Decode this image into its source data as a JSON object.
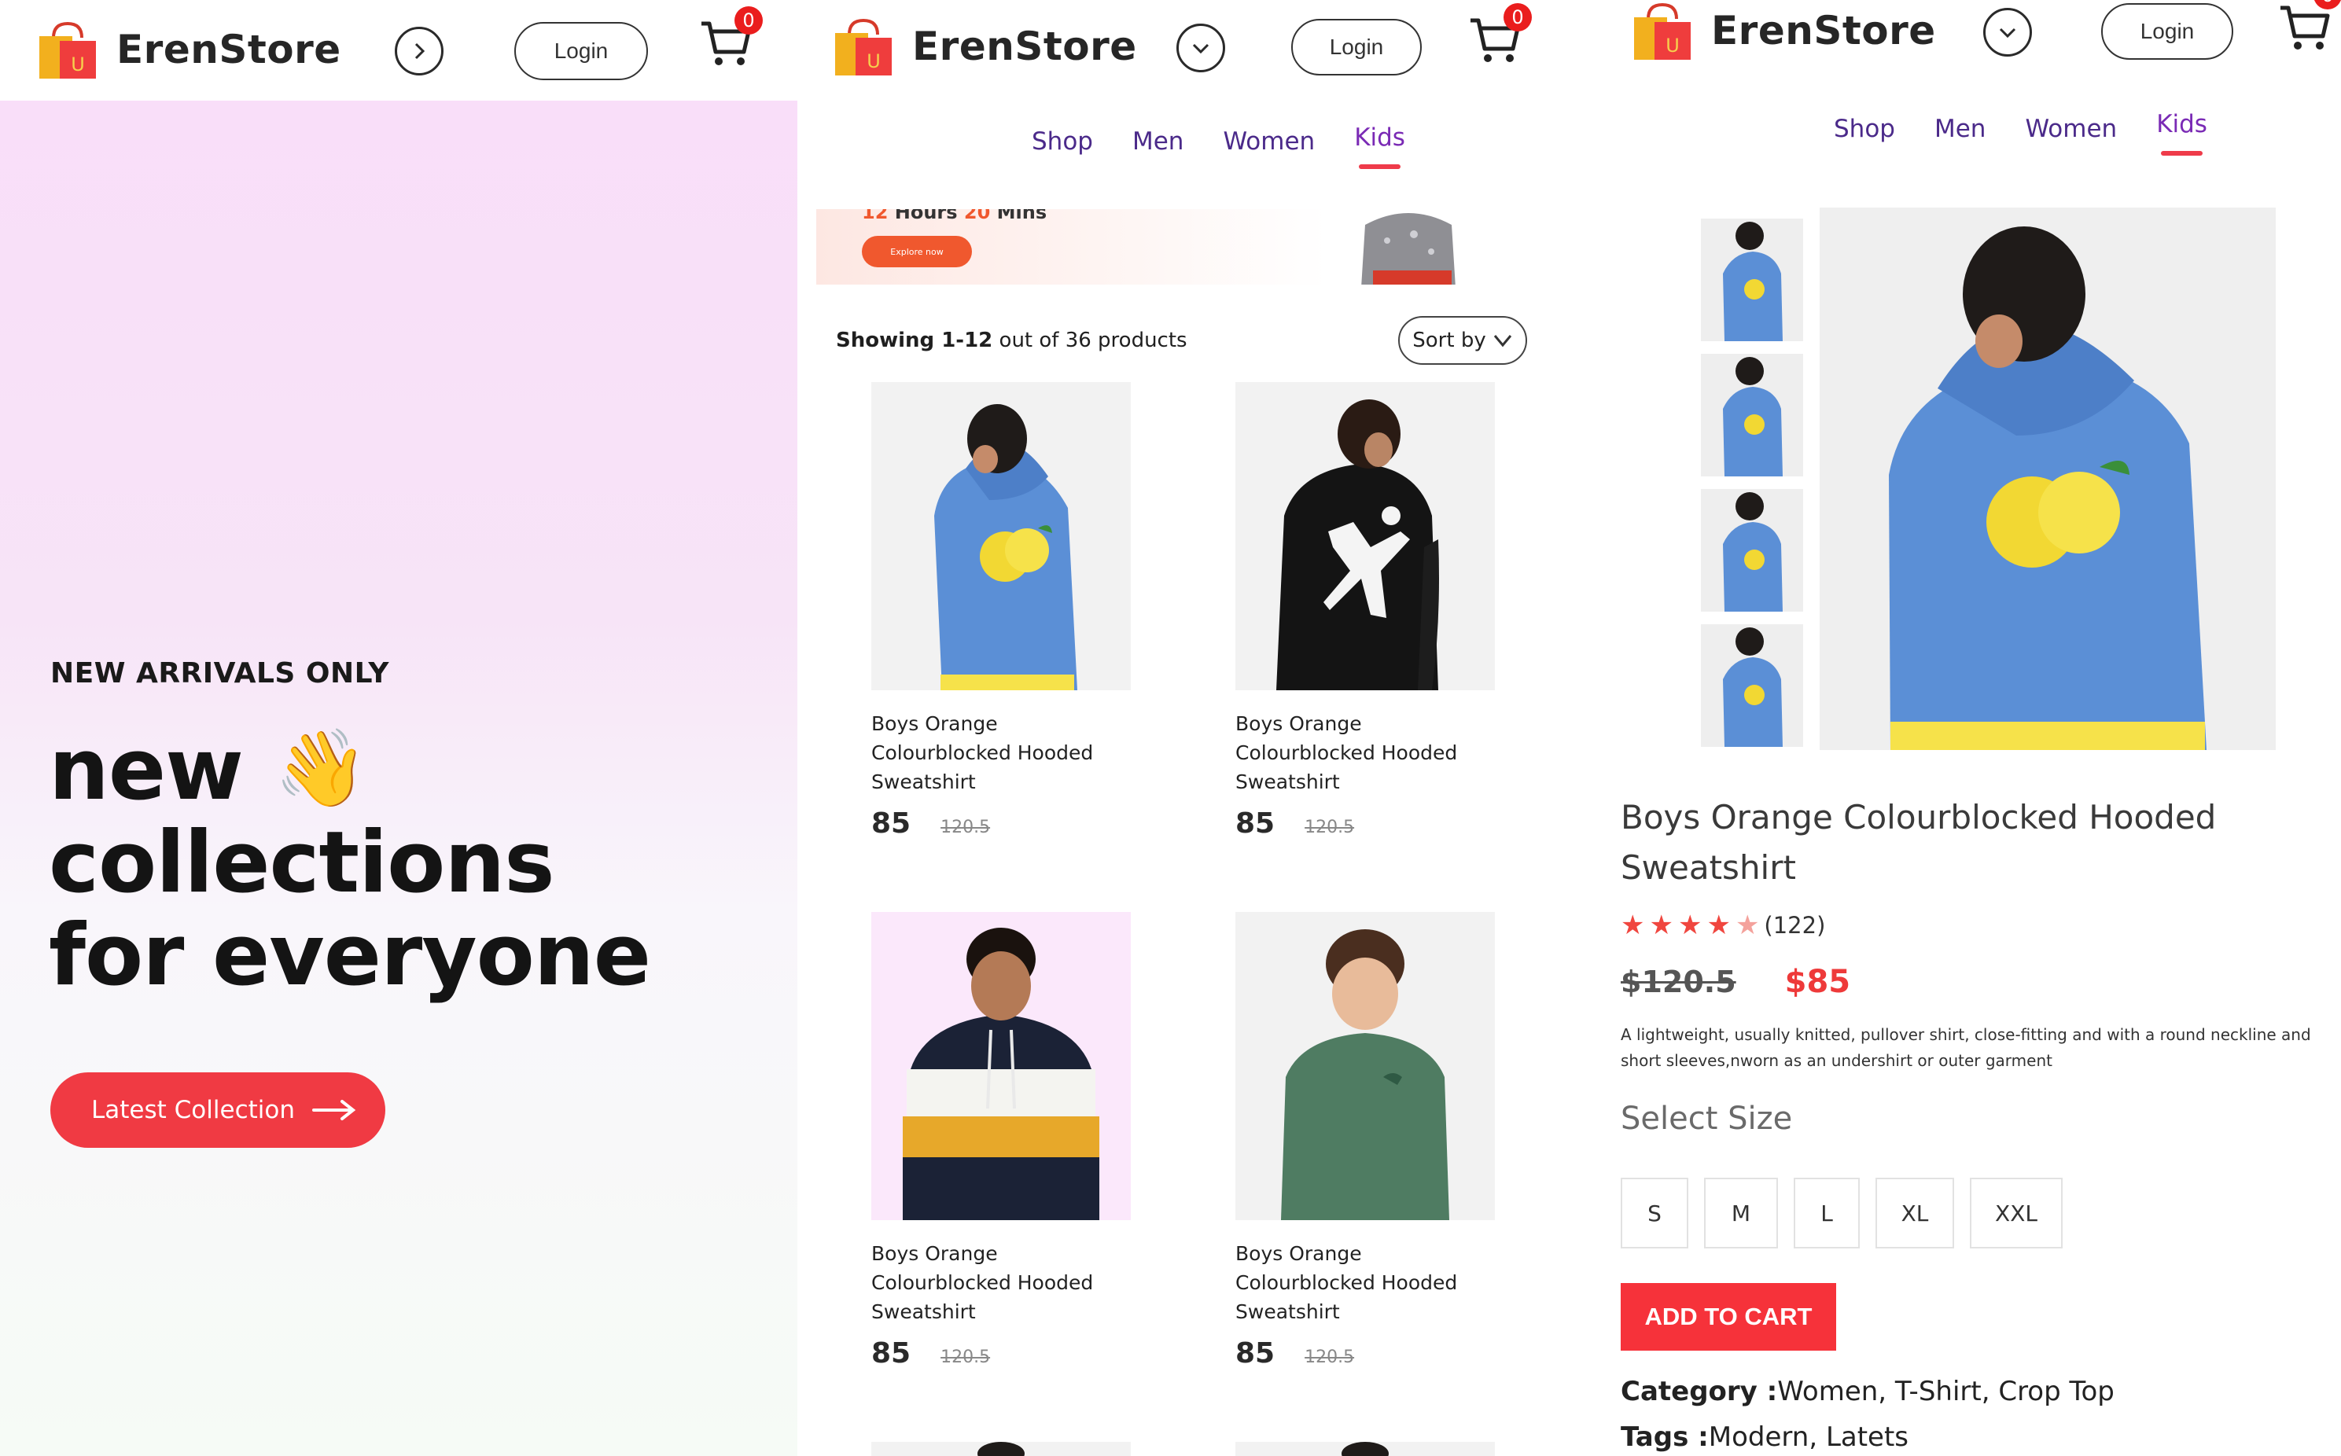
{
  "brand": {
    "name": "ErenStore",
    "logo_letter": "U",
    "colors": {
      "accent": "#F03A43",
      "nav": "#4B2A8A",
      "nav_active": "#7A2AB5",
      "badge": "#EA1D1D"
    }
  },
  "header": {
    "login_label": "Login",
    "cart_count": "0",
    "icons": {
      "toggle": "chevron-circle-icon",
      "cart": "cart-icon",
      "logo": "shopping-bag-icon"
    }
  },
  "hero": {
    "kicker": "NEW ARRIVALS ONLY",
    "title_line1": "new",
    "title_wave": "👋",
    "title_line2": "collections",
    "title_line3": "for everyone",
    "button_label": "Latest Collection",
    "button_icon": "arrow-right-icon"
  },
  "nav": {
    "items": [
      {
        "label": "Shop",
        "active": false
      },
      {
        "label": "Men",
        "active": false
      },
      {
        "label": "Women",
        "active": false
      },
      {
        "label": "Kids",
        "active": true
      }
    ]
  },
  "banner": {
    "text_hours_num": "12",
    "text_hours": "Hours",
    "text_mins_num": "20",
    "text_mins": "Mins",
    "button_label": "Explore now"
  },
  "listing": {
    "showing_range": "Showing 1-12",
    "showing_rest": "out of 36 products",
    "sort_label": "Sort by",
    "products": [
      {
        "name": "Boys Orange Colourblocked Hooded Sweatshirt",
        "price": "85",
        "old_price": "120.5"
      },
      {
        "name": "Boys Orange Colourblocked Hooded Sweatshirt",
        "price": "85",
        "old_price": "120.5"
      },
      {
        "name": "Boys Orange Colourblocked Hooded Sweatshirt",
        "price": "85",
        "old_price": "120.5"
      },
      {
        "name": "Boys Orange Colourblocked Hooded Sweatshirt",
        "price": "85",
        "old_price": "120.5"
      }
    ]
  },
  "detail": {
    "title": "Boys Orange Colourblocked Hooded Sweatshirt",
    "rating": 4,
    "rating_max": 5,
    "review_count": "(122)",
    "old_price": "$120.5",
    "new_price": "$85",
    "description": "A lightweight, usually knitted, pullover shirt, close-fitting and with a round neckline and short sleeves,nworn as an undershirt or outer garment",
    "select_size_label": "Select Size",
    "sizes": [
      "S",
      "M",
      "L",
      "XL",
      "XXL"
    ],
    "add_to_cart_label": "ADD TO CART",
    "category_label": "Category :",
    "category_value": "Women, T-Shirt, Crop Top",
    "tags_label": "Tags :",
    "tags_value": "Modern, Latets"
  }
}
